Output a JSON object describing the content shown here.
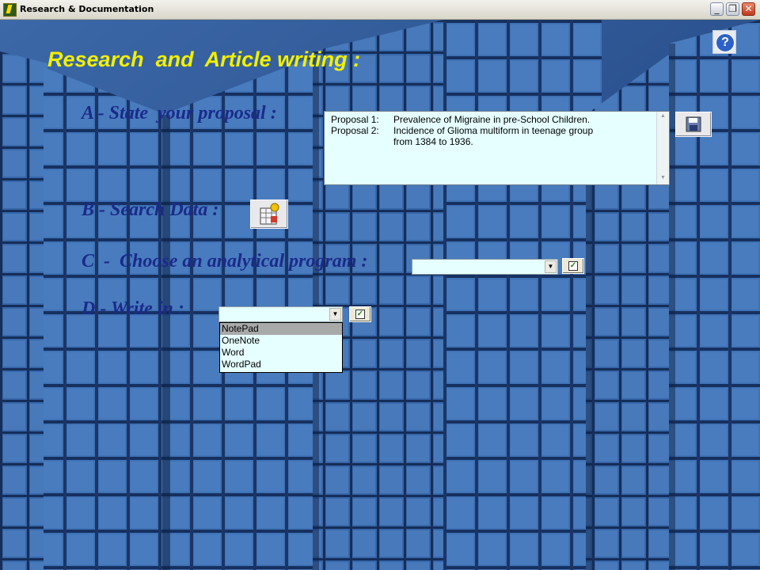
{
  "window": {
    "title": "Research & Documentation"
  },
  "heading": "Research  and  Article writing :",
  "sections": {
    "a_label": "A - State  your proposal :",
    "b_label": "B - Search Data :",
    "c_label": "C  -  Choose an analytical program :",
    "d_label": "D - Write in :"
  },
  "proposals": [
    {
      "key": "Proposal 1:",
      "value": "Prevalence of Migraine in pre-School Children."
    },
    {
      "key": "Proposal 2:",
      "value": "Incidence of Glioma multiform in teenage group"
    },
    {
      "key": "",
      "value": "from 1384 to 1936."
    }
  ],
  "analytical_program": {
    "selected": ""
  },
  "write_in": {
    "selected": "",
    "options": [
      "NotePad",
      "OneNote",
      "Word",
      "WordPad"
    ],
    "highlighted": "NotePad"
  }
}
